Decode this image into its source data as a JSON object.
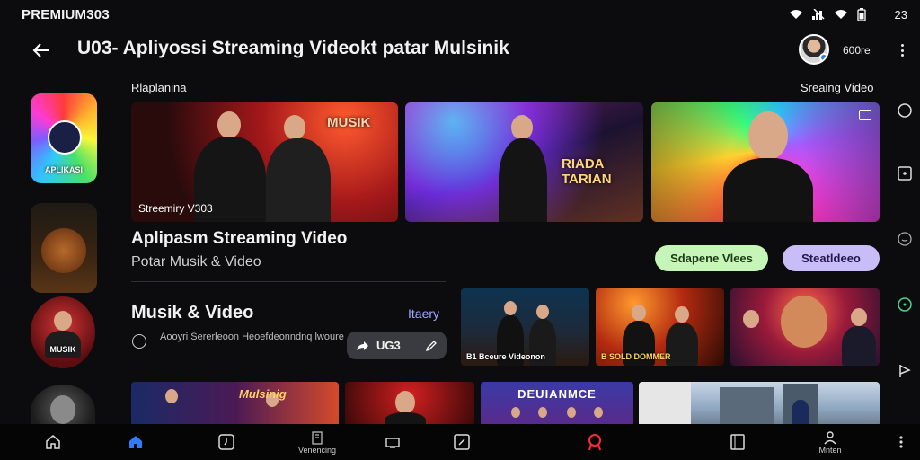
{
  "status_bar": {
    "brand": "PREMIUM303",
    "time": "23",
    "icons": [
      "wifi-icon",
      "signal-icon",
      "wifi-icon",
      "battery-icon"
    ]
  },
  "app_bar": {
    "title": "U03⁠- Apliyossi Streaming Videokt patar Mulsinik",
    "profile_label": "600re"
  },
  "left_rail": [
    {
      "label": "APLIKASI"
    },
    {
      "label": ""
    },
    {
      "label": "MUSIK"
    },
    {
      "label": ""
    }
  ],
  "hero": {
    "section_left": "Rlaplanina",
    "section_right": "Sreaing Video",
    "cards": [
      {
        "caption": "Streemiry V303",
        "overlay": "MUSIK"
      },
      {
        "caption": "",
        "overlay": "RIADA TARIAN"
      },
      {
        "caption": "",
        "overlay": ""
      }
    ],
    "title": "Aplipasm Streaming Video",
    "subtitle": "Potar Musik & Video",
    "pill_primary": "Sdapene Vlees",
    "pill_secondary": "Steatldeeo"
  },
  "music": {
    "title": "Musik & Video",
    "link": "Itaery",
    "description": "Aooyri Sererleoon Heoefdeonndnq lwoure",
    "chip_label": "UG3",
    "cards": [
      {
        "caption": "B1 Bceure Videonon"
      },
      {
        "caption": "B SOLD DOMMER"
      },
      {
        "caption": ""
      }
    ]
  },
  "bottom_row": [
    {
      "overlay": "Mulsinig"
    },
    {
      "overlay": ""
    },
    {
      "overlay": "DEUIANMCE"
    },
    {
      "overlay": ""
    }
  ],
  "bottom_nav": [
    {
      "label": ""
    },
    {
      "label": ""
    },
    {
      "label": ""
    },
    {
      "label": "Venencing"
    },
    {
      "label": ""
    },
    {
      "label": ""
    },
    {
      "label": ""
    },
    {
      "label": ""
    },
    {
      "label": "Mnten"
    }
  ],
  "colors": {
    "accent_blue": "#2f7df6",
    "accent_red": "#ff2a3a",
    "pill_green": "#c6f5b8",
    "pill_purple": "#c9bdf8",
    "link": "#9da7ff"
  }
}
